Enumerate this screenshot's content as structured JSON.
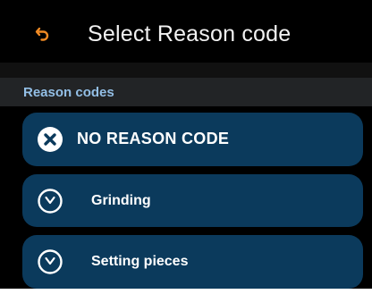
{
  "header": {
    "title": "Select Reason code",
    "back_icon": "undo-arrow-icon",
    "accent_color": "#f08a24"
  },
  "section": {
    "label": "Reason codes"
  },
  "reasons": [
    {
      "label": "NO REASON CODE",
      "icon": "close-circle-icon"
    },
    {
      "label": "Grinding",
      "icon": "clock-icon"
    },
    {
      "label": "Setting pieces",
      "icon": "clock-icon"
    }
  ],
  "colors": {
    "background": "#000000",
    "section_header_bg": "#222426",
    "section_label": "#93bfe6",
    "item_bg": "#0b3a5c",
    "item_text": "#ffffff"
  }
}
